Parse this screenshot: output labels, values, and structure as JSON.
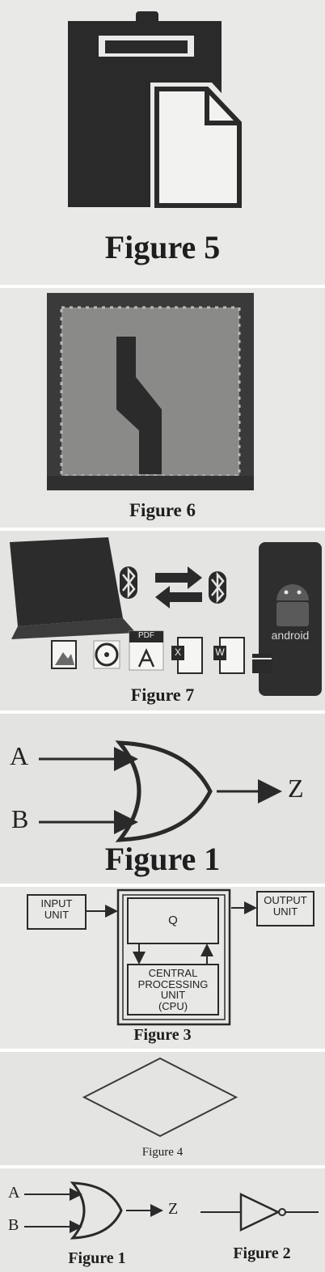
{
  "figure5": {
    "caption": "Figure 5"
  },
  "figure6": {
    "caption": "Figure 6"
  },
  "figure7": {
    "caption": "Figure 7",
    "pdf_badge": "PDF",
    "android_label": "android",
    "excel_letter": "X",
    "word_letter": "W"
  },
  "gate_or": {
    "caption": "Figure 1",
    "input_a": "A",
    "input_b": "B",
    "output": "Z"
  },
  "figure3": {
    "caption": "Figure 3",
    "input_unit_line1": "INPUT",
    "input_unit_line2": "UNIT",
    "output_unit_line1": "OUTPUT",
    "output_unit_line2": "UNIT",
    "memory_label": "Q",
    "cpu_line1": "CENTRAL",
    "cpu_line2": "PROCESSING",
    "cpu_line3": "UNIT",
    "cpu_line4": "(CPU)"
  },
  "figure4": {
    "caption": "Figure 4"
  },
  "figure1_2": {
    "caption_left": "Figure 1",
    "caption_right": "Figure 2",
    "input_a": "A",
    "input_b": "B",
    "output": "Z"
  }
}
